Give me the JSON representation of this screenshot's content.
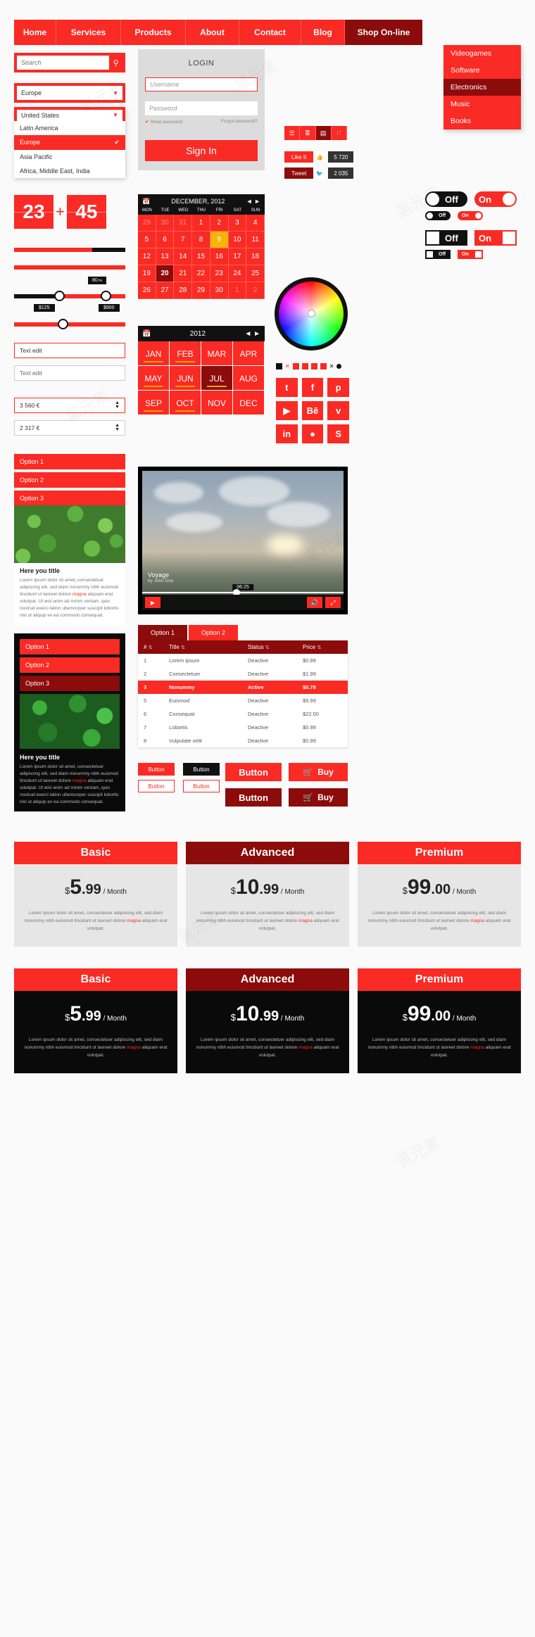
{
  "nav": {
    "items": [
      "Home",
      "Services",
      "Products",
      "About",
      "Contact",
      "Blog"
    ],
    "shop_label": "Shop On-line",
    "shop_menu": [
      "Videogames",
      "Software",
      "Electronics",
      "Music",
      "Books"
    ],
    "shop_menu_selected": "Electronics"
  },
  "search": {
    "placeholder": "Search",
    "icon": "search-icon"
  },
  "selects": {
    "region_value": "Europe",
    "open_value": "United States",
    "options": [
      "United States",
      "Latin America",
      "Europe",
      "Asia Pacific",
      "Africa, Middle East, India"
    ],
    "selected_option": "Europe"
  },
  "login": {
    "title": "LOGIN",
    "username_placeholder": "Username",
    "password_placeholder": "Password",
    "show_password": "Show password",
    "forgot": "Forgot password?",
    "submit": "Sign In"
  },
  "viewbar": {
    "icons": [
      "list-lines-icon",
      "list-bullets-icon",
      "list-detail-icon",
      "grid-icon"
    ],
    "selected_index": 2
  },
  "social_counters": [
    {
      "label": "Like It",
      "icon": "thumbs-up-icon",
      "count": "5 720"
    },
    {
      "label": "Tweet",
      "icon": "twitter-bird-icon",
      "count": "2 035"
    }
  ],
  "flip_counter": {
    "left": "23",
    "right": "45",
    "separator": "+"
  },
  "sliders": {
    "progress_percent": 70,
    "full_percent": 100,
    "tooltip_percent": "80%",
    "range_min_label": "$125",
    "range_max_label": "$900",
    "single_value_percent": 40
  },
  "text_edits": {
    "active": "Text edit",
    "inactive": "Text edit"
  },
  "spinners": {
    "active_value": "3 560 €",
    "inactive_value": "2 317 €"
  },
  "option_list_light": [
    "Option 1",
    "Option 2",
    "Option 3"
  ],
  "option_list_dark": [
    "Option 1",
    "Option 2",
    "Option 3"
  ],
  "card_light": {
    "title": "Here you title",
    "body": "Lorem ipsum dolor sit amet, consectetuer adipiscing elit, sed diam nonummy nibh euismod tincidunt ut laoreet dolore magna aliquam erat volutpat. Ut wisi enim ad minim veniam, quis nostrud exerci tation ullamcorper suscipit lobortis nisl ut aliquip ex ea commodo consequat.",
    "highlight": "magna"
  },
  "card_dark": {
    "title": "Here you title",
    "body": "Lorem ipsum dolor sit amet, consectetuer adipiscing elit, sed diam nonummy nibh euismod tincidunt ut laoreet dolore magna aliquam erat volutpat. Ut wisi enim ad minim veniam, quis nostrud exerci tation ullamcorper suscipit lobortis nisl ut aliquip ex ea commodo consequat.",
    "highlight": "magna"
  },
  "calendar": {
    "icon": "calendar-icon",
    "title": "DECEMBER, 2012",
    "prev": "◄",
    "next": "►",
    "weekdays": [
      "MON",
      "TUE",
      "WED",
      "THU",
      "FRI",
      "SAT",
      "SUN"
    ],
    "days": [
      {
        "n": "29",
        "mute": true
      },
      {
        "n": "30",
        "mute": true
      },
      {
        "n": "31",
        "mute": true
      },
      {
        "n": "1"
      },
      {
        "n": "2"
      },
      {
        "n": "3"
      },
      {
        "n": "4"
      },
      {
        "n": "5"
      },
      {
        "n": "6"
      },
      {
        "n": "7"
      },
      {
        "n": "8"
      },
      {
        "n": "9",
        "today": true
      },
      {
        "n": "10"
      },
      {
        "n": "11"
      },
      {
        "n": "12"
      },
      {
        "n": "13"
      },
      {
        "n": "14"
      },
      {
        "n": "15"
      },
      {
        "n": "16"
      },
      {
        "n": "17"
      },
      {
        "n": "18"
      },
      {
        "n": "19"
      },
      {
        "n": "20",
        "sel": true
      },
      {
        "n": "21"
      },
      {
        "n": "22"
      },
      {
        "n": "23"
      },
      {
        "n": "24"
      },
      {
        "n": "25"
      },
      {
        "n": "26"
      },
      {
        "n": "27"
      },
      {
        "n": "28"
      },
      {
        "n": "29"
      },
      {
        "n": "30"
      },
      {
        "n": "1",
        "mute": true
      },
      {
        "n": "2",
        "mute": true
      }
    ]
  },
  "monthpicker": {
    "icon": "calendar-icon",
    "year": "2012",
    "prev": "◄",
    "next": "►",
    "months": [
      {
        "m": "JAN",
        "u": true
      },
      {
        "m": "FEB",
        "u": true
      },
      {
        "m": "MAR"
      },
      {
        "m": "APR"
      },
      {
        "m": "MAY",
        "u": true
      },
      {
        "m": "JUN",
        "u": true
      },
      {
        "m": "JUL",
        "sel": true,
        "u": true
      },
      {
        "m": "AUG"
      },
      {
        "m": "SEP",
        "u": true
      },
      {
        "m": "OCT",
        "u": true
      },
      {
        "m": "NOV"
      },
      {
        "m": "DEC"
      }
    ]
  },
  "toggles": [
    {
      "state": "Off",
      "style": "round-large-dark"
    },
    {
      "state": "On",
      "style": "round-large-red"
    },
    {
      "state": "Off",
      "style": "round-small-dark"
    },
    {
      "state": "On",
      "style": "round-small-red"
    },
    {
      "state": "Off",
      "style": "square-large-dark"
    },
    {
      "state": "On",
      "style": "square-large-red"
    },
    {
      "state": "Off",
      "style": "square-small-dark"
    },
    {
      "state": "On",
      "style": "square-small-red"
    }
  ],
  "colorwheel": {
    "name": "color-wheel-picker"
  },
  "swatches": [
    "#111111",
    "#ffffff",
    "#fa2a24",
    "#fa2a24",
    "#fa2a24",
    "#fa2a24",
    "#111111",
    "#111111"
  ],
  "social_icons": [
    "twitter-icon",
    "facebook-icon",
    "pinterest-icon",
    "youtube-icon",
    "behance-icon",
    "vimeo-icon",
    "linkedin-icon",
    "dribbble-icon",
    "skype-icon"
  ],
  "social_glyphs": [
    "t",
    "f",
    "p",
    "▶",
    "Bē",
    "v",
    "in",
    "●",
    "S"
  ],
  "video": {
    "title": "Voyage",
    "subtitle": "by John Doe",
    "time": "06:25",
    "play_icon": "play-icon",
    "volume_icon": "volume-icon",
    "fullscreen_icon": "expand-icon"
  },
  "table": {
    "tabs": [
      {
        "label": "Option 1",
        "active": true
      },
      {
        "label": "Option 2",
        "active": false
      }
    ],
    "columns": [
      "#",
      "Title",
      "Status",
      "Price"
    ],
    "rows": [
      {
        "num": "1",
        "title": "Lorem ipsum",
        "status": "Deactive",
        "price": "$0.99",
        "active": false
      },
      {
        "num": "2",
        "title": "Consectetuer",
        "status": "Deactive",
        "price": "$1.99",
        "active": false
      },
      {
        "num": "3",
        "title": "Nonummy",
        "status": "Active",
        "price": "$0.78",
        "active": true
      },
      {
        "num": "5",
        "title": "Euismod",
        "status": "Deactive",
        "price": "$9.99",
        "active": false
      },
      {
        "num": "6",
        "title": "Consequat",
        "status": "Deactive",
        "price": "$22.50",
        "active": false
      },
      {
        "num": "7",
        "title": "Lobortis",
        "status": "Deactive",
        "price": "$0.99",
        "active": false
      },
      {
        "num": "8",
        "title": "Vulputate velit",
        "status": "Deactive",
        "price": "$0.99",
        "active": false
      }
    ]
  },
  "small_buttons": [
    {
      "label": "Button",
      "style": "red-fill"
    },
    {
      "label": "Button",
      "style": "black-fill"
    },
    {
      "label": "Button",
      "style": "red-outline"
    },
    {
      "label": "Button",
      "style": "red-outline-2"
    }
  ],
  "big_buttons": [
    {
      "label": "Button",
      "style": "red"
    },
    {
      "label": "Button",
      "style": "dark"
    }
  ],
  "buy_buttons": [
    {
      "label": "Buy",
      "icon": "cart-icon",
      "style": "red"
    },
    {
      "label": "Buy",
      "icon": "cart-icon",
      "style": "dark"
    }
  ],
  "pricing_light": [
    {
      "name": "Basic",
      "currency": "$",
      "big": "5",
      "cents": ".99",
      "per": "/ Month",
      "header_bg": "#fa2a24",
      "desc": "Lorem ipsum dolor sit amet, consectetuer adipiscing elit, sed diam nonummy nibh euismod tincidunt ut laoreet dolore magna aliquam erat volutpat.",
      "highlight": "magna"
    },
    {
      "name": "Advanced",
      "currency": "$",
      "big": "10",
      "cents": ".99",
      "per": "/ Month",
      "header_bg": "#8c0b0b",
      "desc": "Lorem ipsum dolor sit amet, consectetuer adipiscing elit, sed diam nonummy nibh euismod tincidunt ut laoreet dolore magna aliquam erat volutpat.",
      "highlight": "magna"
    },
    {
      "name": "Premium",
      "currency": "$",
      "big": "99",
      "cents": ".00",
      "per": "/ Month",
      "header_bg": "#fa2a24",
      "desc": "Lorem ipsum dolor sit amet, consectetuer adipiscing elit, sed diam nonummy nibh euismod tincidunt ut laoreet dolore magna aliquam erat volutpat.",
      "highlight": "magna"
    }
  ],
  "pricing_dark": [
    {
      "name": "Basic",
      "currency": "$",
      "big": "5",
      "cents": ".99",
      "per": "/ Month",
      "header_bg": "#fa2a24",
      "desc": "Lorem ipsum dolor sit amet, consectetuer adipiscing elit, sed diam nonummy nibh euismod tincidunt ut laoreet dolore magna aliquam erat volutpat.",
      "highlight": "magna"
    },
    {
      "name": "Advanced",
      "currency": "$",
      "big": "10",
      "cents": ".99",
      "per": "/ Month",
      "header_bg": "#8c0b0b",
      "desc": "Lorem ipsum dolor sit amet, consectetuer adipiscing elit, sed diam nonummy nibh euismod tincidunt ut laoreet dolore magna aliquam erat volutpat.",
      "highlight": "magna"
    },
    {
      "name": "Premium",
      "currency": "$",
      "big": "99",
      "cents": ".00",
      "per": "/ Month",
      "header_bg": "#fa2a24",
      "desc": "Lorem ipsum dolor sit amet, consectetuer adipiscing elit, sed diam nonummy nibh euismod tincidunt ut laoreet dolore magna aliquam erat volutpat.",
      "highlight": "magna"
    }
  ],
  "colors": {
    "primary": "#fa2a24",
    "dark_red": "#8c0b0b",
    "black": "#111111",
    "accent_yellow": "#f5b506"
  }
}
